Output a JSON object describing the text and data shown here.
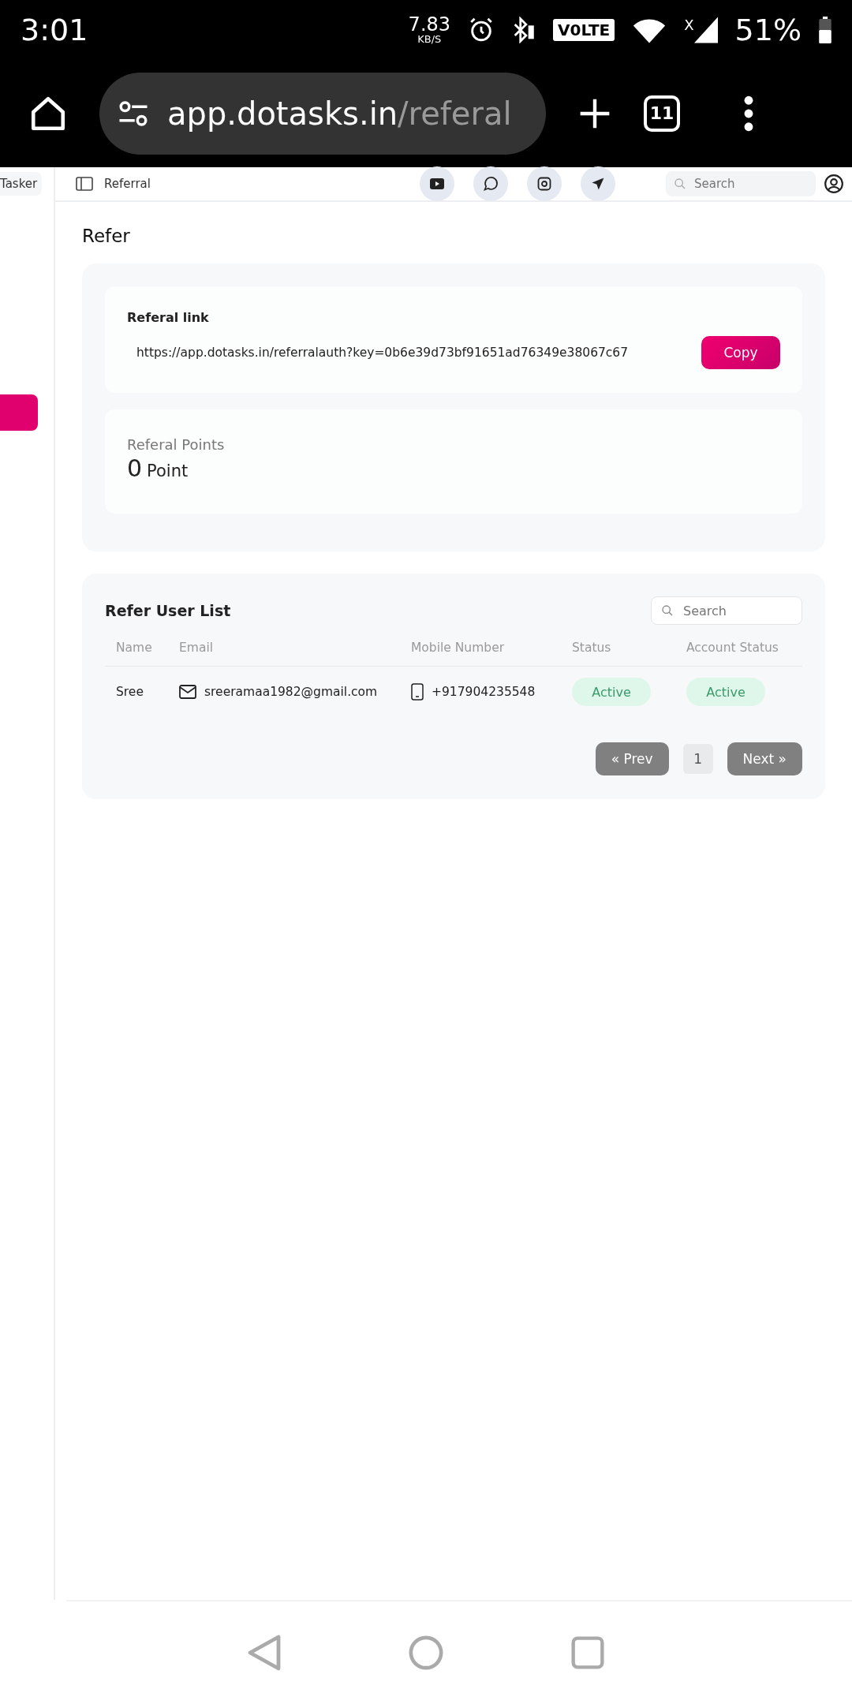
{
  "status_bar": {
    "time": "3:01",
    "speed": "7.83",
    "speed_unit": "KB/S",
    "volte": "V0LTE",
    "network": "X",
    "battery": "51%"
  },
  "browser": {
    "url_host": "app.dotasks.in",
    "url_path": "/referal",
    "tab_count": "11"
  },
  "sidebar": {
    "brand": "Tasker"
  },
  "header": {
    "breadcrumb": "Referral",
    "search_placeholder": "Search"
  },
  "page": {
    "title": "Refer"
  },
  "referral_link": {
    "label": "Referal link",
    "value": "https://app.dotasks.in/referralauth?key=0b6e39d73bf91651ad76349e38067c67",
    "button": "Copy"
  },
  "points": {
    "label": "Referal Points",
    "value": "0",
    "unit": "Point"
  },
  "user_list": {
    "title": "Refer User List",
    "search_placeholder": "Search",
    "columns": [
      "Name",
      "Email",
      "Mobile Number",
      "Status",
      "Account Status"
    ],
    "rows": [
      {
        "name": "Sree",
        "email": "sreeramaa1982@gmail.com",
        "mobile": "+917904235548",
        "status": "Active",
        "account_status": "Active"
      }
    ],
    "pagination": {
      "prev": "« Prev",
      "pages": [
        {
          "label": "1",
          "selected": true
        }
      ],
      "next": "Next »"
    }
  }
}
